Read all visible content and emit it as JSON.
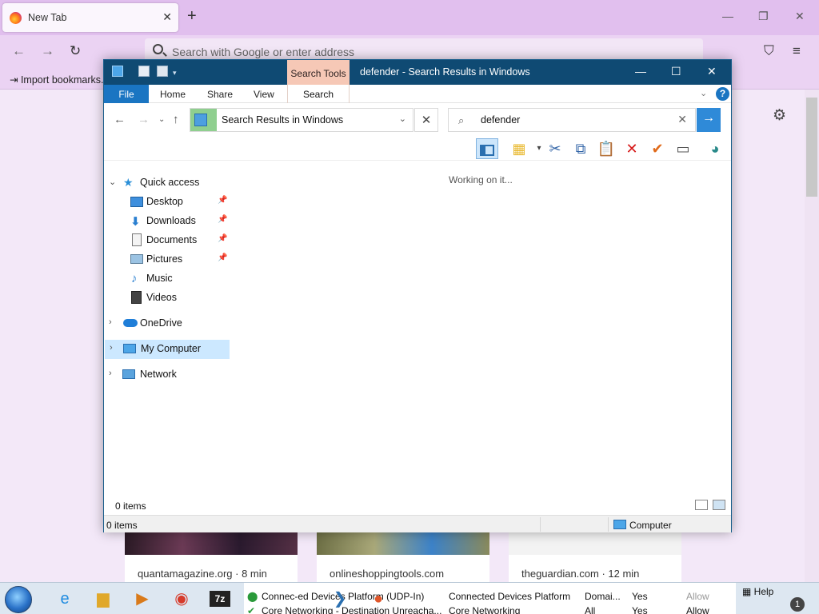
{
  "browser": {
    "tab_title": "New Tab",
    "url_placeholder": "Search with Google or enter address",
    "bookmark_label": "Import bookmarks...",
    "top_sites": [
      {
        "label": "quantamagazine.org · 8 min"
      },
      {
        "label": "onlineshoppingtools.com"
      },
      {
        "label": "theguardian.com · 12 min"
      }
    ]
  },
  "explorer": {
    "context_tab_group": "Search Tools",
    "window_title": "defender - Search Results in Windows",
    "ribbon_tabs": [
      "File",
      "Home",
      "Share",
      "View",
      "Search"
    ],
    "address_path": "Search Results in Windows",
    "search_query": "defender",
    "status_message": "Working on it...",
    "items_count": "0 items",
    "statusbar_count": "0 items",
    "statusbar_location": "Computer",
    "nav": {
      "quick_access": "Quick access",
      "desktop": "Desktop",
      "downloads": "Downloads",
      "documents": "Documents",
      "pictures": "Pictures",
      "music": "Music",
      "videos": "Videos",
      "onedrive": "OneDrive",
      "my_computer": "My Computer",
      "network": "Network"
    }
  },
  "taskbar": {
    "rows": [
      {
        "c1": "Connec‑ed Devices Platform (UDP-In)",
        "c2": "Connected Devices Platform",
        "c3": "Domai...",
        "c4": "Yes",
        "c5": "Allow"
      },
      {
        "c1": "Core Networking - Destination Unreacha...",
        "c2": "Core Networking",
        "c3": "All",
        "c4": "Yes",
        "c5": "Allow"
      }
    ],
    "help": "Help",
    "notification_count": "1"
  },
  "colors": {
    "firefox_tabstrip": "#e1bfee",
    "explorer_titlebar": "#0f4a73",
    "ribbon_file": "#1a75c2",
    "search_tools_tab": "#f6c8b6",
    "nav_selected": "#cce8ff"
  }
}
